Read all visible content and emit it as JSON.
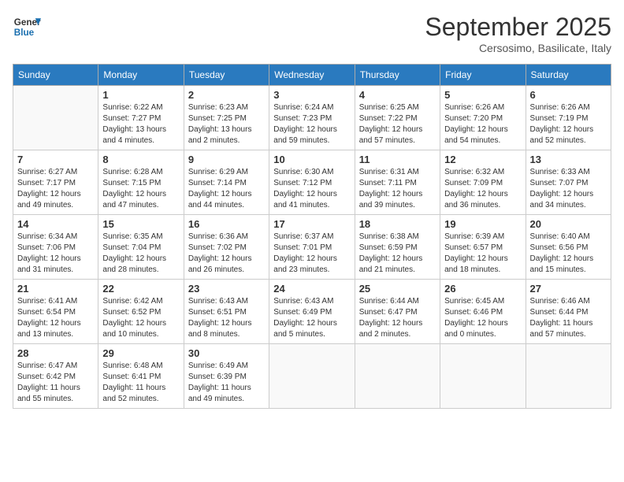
{
  "logo": {
    "line1": "General",
    "line2": "Blue"
  },
  "title": "September 2025",
  "subtitle": "Cersosimo, Basilicate, Italy",
  "weekdays": [
    "Sunday",
    "Monday",
    "Tuesday",
    "Wednesday",
    "Thursday",
    "Friday",
    "Saturday"
  ],
  "weeks": [
    [
      {
        "day": "",
        "info": ""
      },
      {
        "day": "1",
        "info": "Sunrise: 6:22 AM\nSunset: 7:27 PM\nDaylight: 13 hours\nand 4 minutes."
      },
      {
        "day": "2",
        "info": "Sunrise: 6:23 AM\nSunset: 7:25 PM\nDaylight: 13 hours\nand 2 minutes."
      },
      {
        "day": "3",
        "info": "Sunrise: 6:24 AM\nSunset: 7:23 PM\nDaylight: 12 hours\nand 59 minutes."
      },
      {
        "day": "4",
        "info": "Sunrise: 6:25 AM\nSunset: 7:22 PM\nDaylight: 12 hours\nand 57 minutes."
      },
      {
        "day": "5",
        "info": "Sunrise: 6:26 AM\nSunset: 7:20 PM\nDaylight: 12 hours\nand 54 minutes."
      },
      {
        "day": "6",
        "info": "Sunrise: 6:26 AM\nSunset: 7:19 PM\nDaylight: 12 hours\nand 52 minutes."
      }
    ],
    [
      {
        "day": "7",
        "info": "Sunrise: 6:27 AM\nSunset: 7:17 PM\nDaylight: 12 hours\nand 49 minutes."
      },
      {
        "day": "8",
        "info": "Sunrise: 6:28 AM\nSunset: 7:15 PM\nDaylight: 12 hours\nand 47 minutes."
      },
      {
        "day": "9",
        "info": "Sunrise: 6:29 AM\nSunset: 7:14 PM\nDaylight: 12 hours\nand 44 minutes."
      },
      {
        "day": "10",
        "info": "Sunrise: 6:30 AM\nSunset: 7:12 PM\nDaylight: 12 hours\nand 41 minutes."
      },
      {
        "day": "11",
        "info": "Sunrise: 6:31 AM\nSunset: 7:11 PM\nDaylight: 12 hours\nand 39 minutes."
      },
      {
        "day": "12",
        "info": "Sunrise: 6:32 AM\nSunset: 7:09 PM\nDaylight: 12 hours\nand 36 minutes."
      },
      {
        "day": "13",
        "info": "Sunrise: 6:33 AM\nSunset: 7:07 PM\nDaylight: 12 hours\nand 34 minutes."
      }
    ],
    [
      {
        "day": "14",
        "info": "Sunrise: 6:34 AM\nSunset: 7:06 PM\nDaylight: 12 hours\nand 31 minutes."
      },
      {
        "day": "15",
        "info": "Sunrise: 6:35 AM\nSunset: 7:04 PM\nDaylight: 12 hours\nand 28 minutes."
      },
      {
        "day": "16",
        "info": "Sunrise: 6:36 AM\nSunset: 7:02 PM\nDaylight: 12 hours\nand 26 minutes."
      },
      {
        "day": "17",
        "info": "Sunrise: 6:37 AM\nSunset: 7:01 PM\nDaylight: 12 hours\nand 23 minutes."
      },
      {
        "day": "18",
        "info": "Sunrise: 6:38 AM\nSunset: 6:59 PM\nDaylight: 12 hours\nand 21 minutes."
      },
      {
        "day": "19",
        "info": "Sunrise: 6:39 AM\nSunset: 6:57 PM\nDaylight: 12 hours\nand 18 minutes."
      },
      {
        "day": "20",
        "info": "Sunrise: 6:40 AM\nSunset: 6:56 PM\nDaylight: 12 hours\nand 15 minutes."
      }
    ],
    [
      {
        "day": "21",
        "info": "Sunrise: 6:41 AM\nSunset: 6:54 PM\nDaylight: 12 hours\nand 13 minutes."
      },
      {
        "day": "22",
        "info": "Sunrise: 6:42 AM\nSunset: 6:52 PM\nDaylight: 12 hours\nand 10 minutes."
      },
      {
        "day": "23",
        "info": "Sunrise: 6:43 AM\nSunset: 6:51 PM\nDaylight: 12 hours\nand 8 minutes."
      },
      {
        "day": "24",
        "info": "Sunrise: 6:43 AM\nSunset: 6:49 PM\nDaylight: 12 hours\nand 5 minutes."
      },
      {
        "day": "25",
        "info": "Sunrise: 6:44 AM\nSunset: 6:47 PM\nDaylight: 12 hours\nand 2 minutes."
      },
      {
        "day": "26",
        "info": "Sunrise: 6:45 AM\nSunset: 6:46 PM\nDaylight: 12 hours\nand 0 minutes."
      },
      {
        "day": "27",
        "info": "Sunrise: 6:46 AM\nSunset: 6:44 PM\nDaylight: 11 hours\nand 57 minutes."
      }
    ],
    [
      {
        "day": "28",
        "info": "Sunrise: 6:47 AM\nSunset: 6:42 PM\nDaylight: 11 hours\nand 55 minutes."
      },
      {
        "day": "29",
        "info": "Sunrise: 6:48 AM\nSunset: 6:41 PM\nDaylight: 11 hours\nand 52 minutes."
      },
      {
        "day": "30",
        "info": "Sunrise: 6:49 AM\nSunset: 6:39 PM\nDaylight: 11 hours\nand 49 minutes."
      },
      {
        "day": "",
        "info": ""
      },
      {
        "day": "",
        "info": ""
      },
      {
        "day": "",
        "info": ""
      },
      {
        "day": "",
        "info": ""
      }
    ]
  ]
}
